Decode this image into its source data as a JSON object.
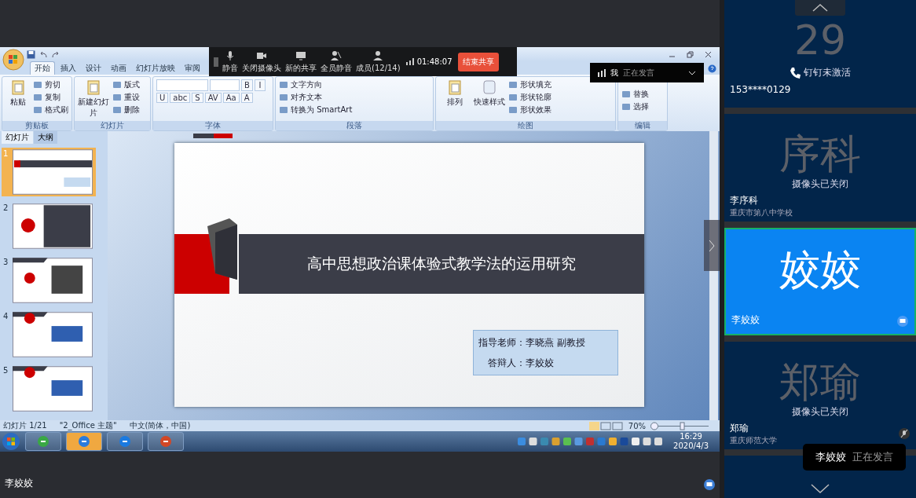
{
  "share_toolbar": {
    "buttons": [
      {
        "label": "静音"
      },
      {
        "label": "关闭摄像头"
      },
      {
        "label": "新的共享"
      },
      {
        "label": "全员静音"
      },
      {
        "label": "成员(12/14)"
      }
    ],
    "timer": "01:48:07",
    "end_button": "结束共享"
  },
  "speaking_badge": {
    "name": "我",
    "status": "正在发言"
  },
  "ppt": {
    "tabs": [
      {
        "label": "开始",
        "selected": true
      },
      {
        "label": "插入",
        "selected": false
      },
      {
        "label": "设计",
        "selected": false
      },
      {
        "label": "动画",
        "selected": false
      },
      {
        "label": "幻灯片放映",
        "selected": false
      },
      {
        "label": "审阅",
        "selected": false
      }
    ],
    "ribbon_groups": [
      {
        "title": "剪贴板",
        "big": "粘贴",
        "items": [
          "剪切",
          "复制",
          "格式刷"
        ]
      },
      {
        "title": "幻灯片",
        "big": "新建幻灯片",
        "items": [
          "版式",
          "重设",
          "删除"
        ]
      },
      {
        "title": "字体",
        "format_buttons": [
          "B",
          "I",
          "U",
          "abc",
          "S",
          "AV",
          "Aa",
          "A"
        ]
      },
      {
        "title": "段落",
        "items": [
          "文字方向",
          "对齐文本",
          "转换为 SmartArt"
        ]
      },
      {
        "title": "绘图",
        "big": "排列",
        "big2": "快速样式",
        "items": [
          "形状填充",
          "形状轮廓",
          "形状效果"
        ]
      },
      {
        "title": "编辑",
        "items": [
          "替换",
          "选择"
        ]
      }
    ],
    "panel_tabs": [
      {
        "label": "幻灯片",
        "selected": true
      },
      {
        "label": "大纲",
        "selected": false
      }
    ],
    "slides": [
      {
        "number": "1",
        "selected": true
      },
      {
        "number": "2",
        "selected": false
      },
      {
        "number": "3",
        "selected": false
      },
      {
        "number": "4",
        "selected": false
      },
      {
        "number": "5",
        "selected": false
      }
    ],
    "slide": {
      "title": "高中思想政治课体验式教学法的运用研究",
      "advisor": "指导老师：李晓燕  副教授",
      "presenter": "答辩人：李姣姣"
    },
    "status_bar": {
      "slide_count": "幻灯片 1/21",
      "theme": "\"2_Office 主题\"",
      "language": "中文(简体，中国)",
      "zoom": "70%"
    },
    "taskbar": {
      "time": "16:29",
      "date": "2020/4/3"
    }
  },
  "participants": [
    {
      "avatar_text": "29",
      "status": "钉钉未激活",
      "name": "153****0129",
      "speaking": false,
      "muted": false,
      "sharing": false,
      "phone": true
    },
    {
      "avatar_text": "序科",
      "status": "摄像头已关闭",
      "name": "李序科",
      "org": "重庆市第八中学校",
      "speaking": false,
      "muted": false,
      "sharing": false,
      "phone": false
    },
    {
      "avatar_text": "姣姣",
      "name": "李姣姣",
      "speaking": true,
      "muted": false,
      "sharing": true,
      "phone": false
    },
    {
      "avatar_text": "郑瑜",
      "status": "摄像头已关闭",
      "name": "郑瑜",
      "org": "重庆师范大学",
      "speaking": false,
      "muted": true,
      "sharing": false,
      "phone": false
    }
  ],
  "speaking_toast": {
    "name": "李姣姣",
    "status": "正在发言"
  },
  "presenter_label": "李姣姣"
}
